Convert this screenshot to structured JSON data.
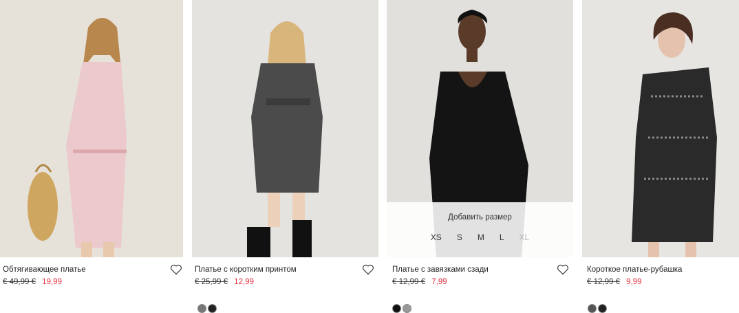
{
  "products": [
    {
      "name": "Обтягивающее платье",
      "old_price": "€ 49,99 €",
      "price": "19,99",
      "bg": "#e6e2da",
      "dress": "#e9c9cc"
    },
    {
      "name": "Платье с коротким принтом",
      "old_price": "€ 25,99 €",
      "price": "12,99",
      "bg": "#e5e3df",
      "dress": "#4b4b4b"
    },
    {
      "name": "Платье с завязками сзади",
      "old_price": "€ 12,99 €",
      "price": "7,99",
      "bg": "#e2e0dc",
      "dress": "#141414",
      "size_picker": {
        "title": "Добавить размер",
        "sizes": [
          "XS",
          "S",
          "M",
          "L",
          "XL"
        ]
      }
    },
    {
      "name": "Короткое платье-рубашка",
      "old_price": "€ 12,99 €",
      "price": "9,99",
      "bg": "#e7e5e1",
      "dress": "#2a2a2a"
    }
  ],
  "colors": {
    "sale_price": "#e0303e"
  },
  "icons": {
    "favorite": "heart-outline-icon"
  }
}
